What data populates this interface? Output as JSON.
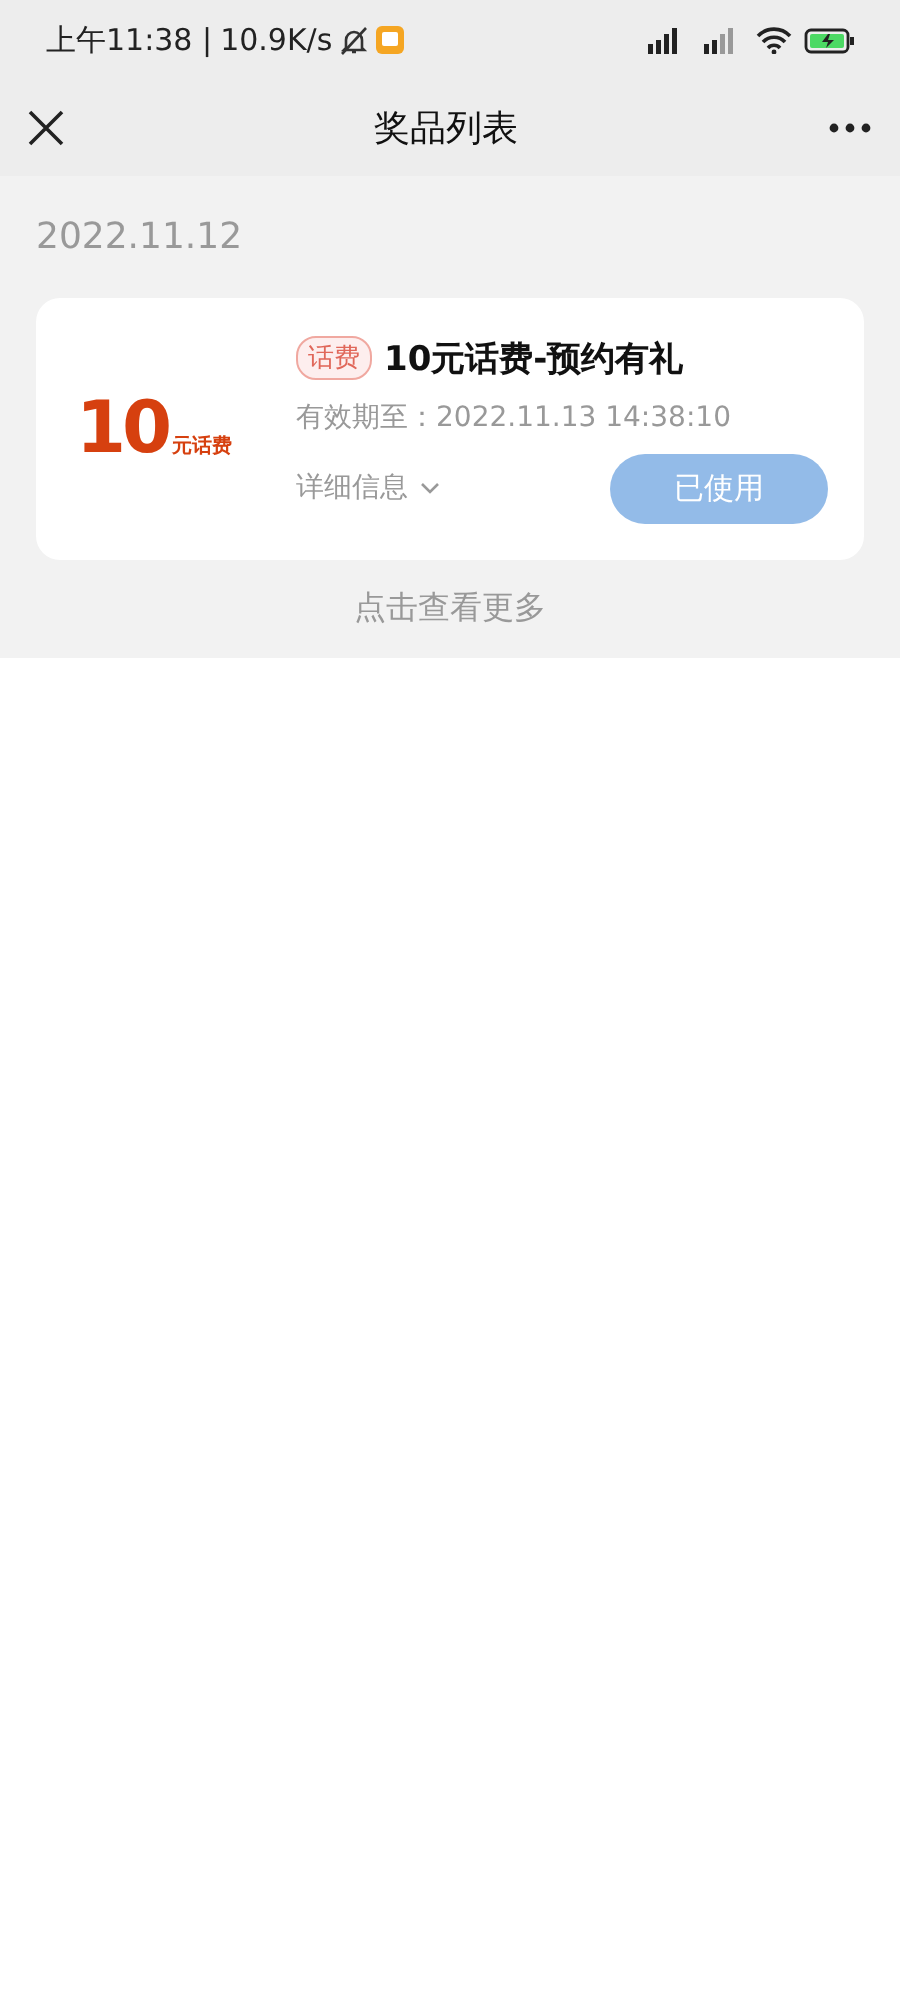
{
  "status_bar": {
    "time": "上午11:38 |",
    "speed": "10.9K/s"
  },
  "header": {
    "title": "奖品列表"
  },
  "date": "2022.11.12",
  "prizes": [
    {
      "amount": "10",
      "unit": "元话费",
      "tag": "话费",
      "name": "10元话费-预约有礼",
      "expiry": "有效期至：2022.11.13 14:38:10",
      "details": "详细信息",
      "details_expanded": false,
      "button": "已使用",
      "disabled": true
    }
  ],
  "more": "点击查看更多"
}
